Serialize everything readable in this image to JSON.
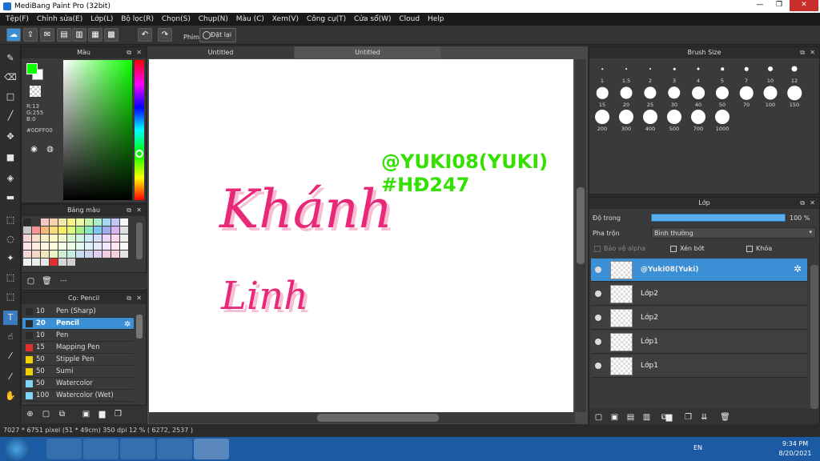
{
  "window": {
    "title": "MediBang Paint Pro (32bit)",
    "min": "—",
    "restore": "❐",
    "close": "✕"
  },
  "menu": [
    "Tệp(F)",
    "Chỉnh sửa(E)",
    "Lớp(L)",
    "Bộ lọc(R)",
    "Chọn(S)",
    "Chụp(N)",
    "Màu (C)",
    "Xem(V)",
    "Công cụ(T)",
    "Cửa sổ(W)",
    "Cloud",
    "Help"
  ],
  "toolbar": {
    "phim_label": "Phím",
    "ok_label": "Đặt lại"
  },
  "color_panel": {
    "title": "Màu",
    "r": "R:13",
    "g": "G:255",
    "b": "B:0",
    "hex": "#0DFF00",
    "fg_color": "#0dff00"
  },
  "palette_panel": {
    "title": "Bảng màu",
    "footer_text": "---",
    "colors": [
      "#2a2a2a",
      "#3a3a3a",
      "#f6c6c6",
      "#f7d2a9",
      "#f5e6a9",
      "#fbf28c",
      "#ebf9a2",
      "#c6f4a8",
      "#a8eecd",
      "#a6d8f3",
      "#c0c9f5",
      "#f6f6f6",
      "#c7c7c7",
      "#f49494",
      "#f6b97b",
      "#f4de79",
      "#f8ee5f",
      "#e1f87c",
      "#a8ef86",
      "#86e7c0",
      "#7fc7ef",
      "#a0adf1",
      "#d8b5f5",
      "#e0e0e0",
      "#f8d2d2",
      "#fae0c8",
      "#f9f0c8",
      "#fcf8c5",
      "#f1fbce",
      "#dcf8cf",
      "#cff5e5",
      "#cde9f8",
      "#d7ddfa",
      "#ead7fa",
      "#fbd8ee",
      "#f0f0f0",
      "#fbe5e5",
      "#fcede0",
      "#fbf6e0",
      "#fdfbdf",
      "#f7fde4",
      "#e9fbe3",
      "#e2f9f0",
      "#e1f1fb",
      "#e6eafc",
      "#f2e6fc",
      "#fce6f4",
      "#fafafa",
      "#f7d6d6",
      "#f5d9c4",
      "#f3e7c2",
      "#eaf3c2",
      "#cfeed1",
      "#c8ebe4",
      "#c6dcef",
      "#d0d2f1",
      "#e2cdef",
      "#efcde4",
      "#f7d1d8",
      "#e4e4e4",
      "#f2f2f2",
      "#ececec",
      "#e6e6e6",
      "#e03030",
      "#d6d6d6",
      "#d0d0d0"
    ]
  },
  "brush_panel": {
    "title": "Cọ: Pencil",
    "items": [
      {
        "size": "10",
        "name": "Pen (Sharp)",
        "color": "#2a2a2a"
      },
      {
        "size": "20",
        "name": "Pencil",
        "color": "#2a2a2a"
      },
      {
        "size": "10",
        "name": "Pen",
        "color": "#2a2a2a"
      },
      {
        "size": "15",
        "name": "Mapping Pen",
        "color": "#e03030"
      },
      {
        "size": "50",
        "name": "Stipple Pen",
        "color": "#f0d000"
      },
      {
        "size": "50",
        "name": "Sumi",
        "color": "#f0d000"
      },
      {
        "size": "50",
        "name": "Watercolor",
        "color": "#7fd4f7"
      },
      {
        "size": "100",
        "name": "Watercolor (Wet)",
        "color": "#7fd4f7"
      }
    ]
  },
  "canvas": {
    "tabs": [
      "Untitled",
      "Untitled"
    ],
    "text_main1": "Khánh",
    "text_main2": "Linh",
    "text_tag1": "@YUKI08(YUKI)",
    "text_tag2": "#HĐ247"
  },
  "brush_size": {
    "title": "Brush Size",
    "sizes": [
      "1",
      "1.5",
      "2",
      "3",
      "4",
      "5",
      "7",
      "10",
      "12",
      "15",
      "20",
      "25",
      "30",
      "40",
      "50",
      "70",
      "100",
      "150",
      "200",
      "300",
      "400",
      "500",
      "700",
      "1000"
    ]
  },
  "layers": {
    "title": "Lớp",
    "opacity_label": "Độ trong",
    "opacity_value": "100 %",
    "blend_label": "Pha trộn",
    "blend_value": "Bình thường",
    "alpha_label": "Bảo vệ alpha",
    "clip_label": "Xén bớt",
    "lock_label": "Khóa",
    "items": [
      "@Yuki08(Yuki)",
      "Lớp2",
      "Lớp2",
      "Lớp1",
      "Lớp1"
    ]
  },
  "status": {
    "text": "7027 * 6751 pixel   (51 * 49cm)   350 dpi   12 %   ( 6272, 2537 )"
  },
  "taskbar": {
    "lang": "EN",
    "time": "9:34 PM",
    "date": "8/20/2021"
  }
}
